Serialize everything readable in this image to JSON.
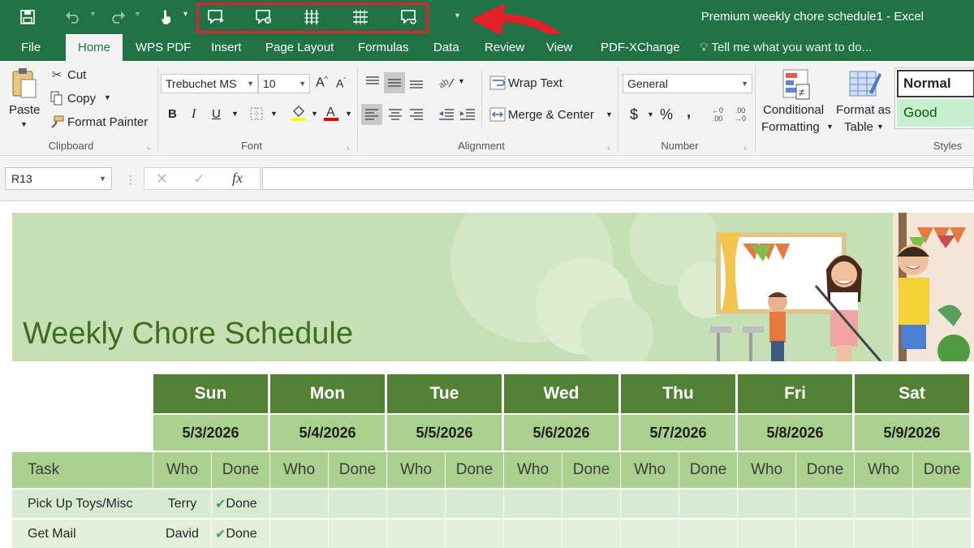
{
  "window": {
    "title": "Premium weekly chore schedule1 - Excel"
  },
  "quick_access": {
    "icons": [
      "save-icon",
      "undo-icon",
      "redo-icon",
      "touch-mode-icon",
      "new-comment-icon",
      "delete-comment-icon",
      "insert-column-icon",
      "insert-row-icon",
      "show-comments-icon",
      "customize-qat-icon"
    ]
  },
  "tabs": [
    {
      "label": "File"
    },
    {
      "label": "Home"
    },
    {
      "label": "WPS PDF"
    },
    {
      "label": "Insert"
    },
    {
      "label": "Page Layout"
    },
    {
      "label": "Formulas"
    },
    {
      "label": "Data"
    },
    {
      "label": "Review"
    },
    {
      "label": "View"
    },
    {
      "label": "PDF-XChange"
    }
  ],
  "tell_me": "Tell me what you want to do...",
  "ribbon": {
    "clipboard": {
      "label": "Clipboard",
      "paste": "Paste",
      "cut": "Cut",
      "copy": "Copy",
      "format_painter": "Format Painter"
    },
    "font": {
      "label": "Font",
      "family": "Trebuchet MS",
      "size": "10",
      "bold": "B",
      "italic": "I",
      "underline": "U"
    },
    "alignment": {
      "label": "Alignment",
      "wrap_text": "Wrap Text",
      "merge_center": "Merge & Center"
    },
    "number": {
      "label": "Number",
      "format": "General",
      "currency": "$",
      "percent": "%",
      "comma": ","
    },
    "styles": {
      "label": "Styles",
      "conditional": "Conditional",
      "formatting": "Formatting",
      "format_as": "Format as",
      "table": "Table",
      "normal": "Normal",
      "good": "Good"
    }
  },
  "formula_bar": {
    "name_box": "R13",
    "fx": "fx",
    "value": ""
  },
  "sheet": {
    "title": "Weekly Chore Schedule",
    "task_header": "Task",
    "days": [
      {
        "name": "Sun",
        "date": "5/3/2026",
        "who": "Who",
        "done": "Done"
      },
      {
        "name": "Mon",
        "date": "5/4/2026",
        "who": "Who",
        "done": "Done"
      },
      {
        "name": "Tue",
        "date": "5/5/2026",
        "who": "Who",
        "done": "Done"
      },
      {
        "name": "Wed",
        "date": "5/6/2026",
        "who": "Who",
        "done": "Done"
      },
      {
        "name": "Thu",
        "date": "5/7/2026",
        "who": "Who",
        "done": "Done"
      },
      {
        "name": "Fri",
        "date": "5/8/2026",
        "who": "Who",
        "done": "Done"
      },
      {
        "name": "Sat",
        "date": "5/9/2026",
        "who": "Who",
        "done": "Done"
      }
    ],
    "rows": [
      {
        "task": "Pick Up Toys/Misc",
        "sun_who": "Terry",
        "sun_done": "Done"
      },
      {
        "task": "Get Mail",
        "sun_who": "David",
        "sun_done": "Done"
      }
    ]
  },
  "colors": {
    "excel_green": "#217346",
    "header_green": "#538135",
    "light_green": "#a9d08e",
    "highlight_red": "#e5202b"
  }
}
